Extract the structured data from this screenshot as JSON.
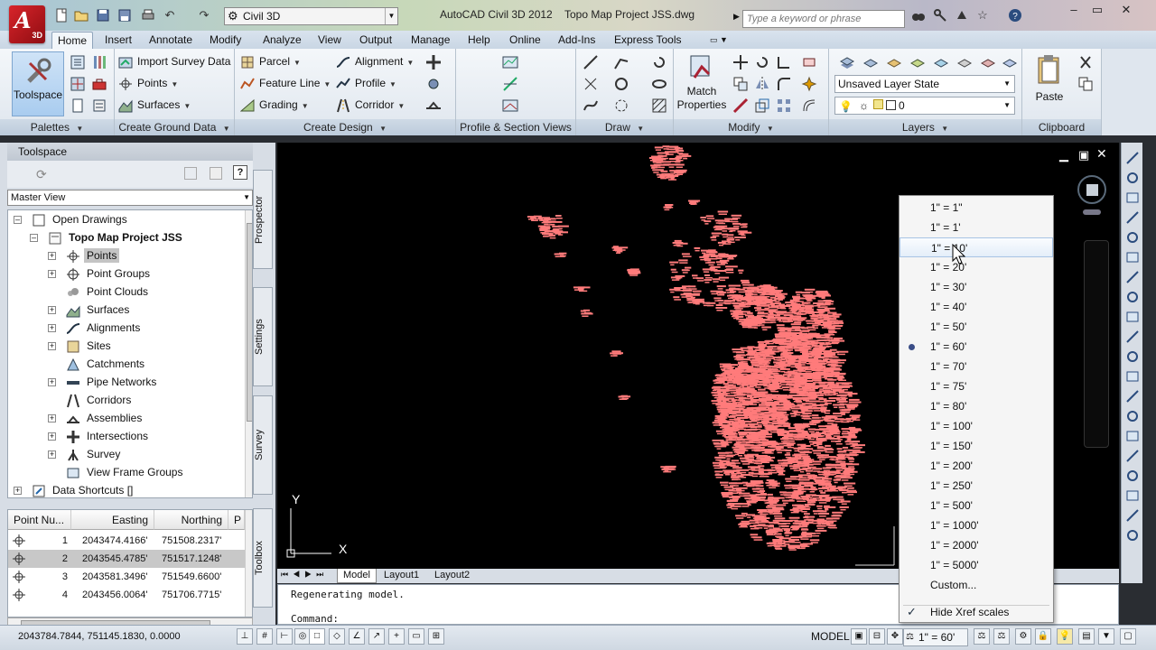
{
  "app": {
    "title": "AutoCAD Civil 3D 2012",
    "document": "Topo Map Project JSS.dwg",
    "logo_text": "3D",
    "logo_letter": "A",
    "workspace": "Civil 3D",
    "search_placeholder": "Type a keyword or phrase"
  },
  "ribbon_tabs": [
    "Home",
    "Insert",
    "Annotate",
    "Modify",
    "Analyze",
    "View",
    "Output",
    "Manage",
    "Help",
    "Online",
    "Add-Ins",
    "Express Tools"
  ],
  "ribbon": {
    "palettes": {
      "title": "Palettes",
      "toolspace": "Toolspace"
    },
    "ground": {
      "title": "Create Ground Data",
      "import": "Import Survey Data",
      "points": "Points",
      "surfaces": "Surfaces"
    },
    "design": {
      "title": "Create Design",
      "parcel": "Parcel",
      "feature_line": "Feature Line",
      "grading": "Grading",
      "alignment": "Alignment",
      "profile": "Profile",
      "corridor": "Corridor"
    },
    "profile_section": {
      "title": "Profile & Section Views"
    },
    "draw": {
      "title": "Draw"
    },
    "modify": {
      "title": "Modify",
      "match": "Match",
      "properties": "Properties"
    },
    "layers": {
      "title": "Layers",
      "layer_state": "Unsaved Layer State",
      "current_layer": "0"
    },
    "clipboard": {
      "title": "Clipboard",
      "paste": "Paste"
    }
  },
  "toolspace": {
    "header": "Toolspace",
    "view": "Master View",
    "tree": {
      "root": "Open Drawings",
      "drawing": "Topo Map Project JSS",
      "items": [
        "Points",
        "Point Groups",
        "Point Clouds",
        "Surfaces",
        "Alignments",
        "Sites",
        "Catchments",
        "Pipe Networks",
        "Corridors",
        "Assemblies",
        "Intersections",
        "Survey",
        "View Frame Groups"
      ],
      "shortcuts": "Data Shortcuts []"
    },
    "side_tabs": [
      "Prospector",
      "Settings",
      "Survey",
      "Toolbox"
    ],
    "table": {
      "columns": [
        "Point Nu...",
        "Easting",
        "Northing",
        "P"
      ],
      "rows": [
        {
          "num": "1",
          "easting": "2043474.4166'",
          "northing": "751508.2317'"
        },
        {
          "num": "2",
          "easting": "2043545.4785'",
          "northing": "751517.1248'"
        },
        {
          "num": "3",
          "easting": "2043581.3496'",
          "northing": "751549.6600'"
        },
        {
          "num": "4",
          "easting": "2043456.0064'",
          "northing": "751706.7715'"
        }
      ]
    }
  },
  "drawing": {
    "ucs_x": "X",
    "ucs_y": "Y",
    "point_color": "#ff7b7b",
    "layout_tabs": [
      "Model",
      "Layout1",
      "Layout2"
    ]
  },
  "command": {
    "history": "Regenerating model.",
    "prompt": "Command:"
  },
  "status": {
    "coords": "2043784.7844, 751145.1830, 0.0000",
    "space": "MODEL",
    "scale": "1\" = 60'"
  },
  "scale_menu": {
    "items": [
      "1\" = 1\"",
      "1\" = 1'",
      "1\" = 10'",
      "1\" = 20'",
      "1\" = 30'",
      "1\" = 40'",
      "1\" = 50'",
      "1\" = 60'",
      "1\" = 70'",
      "1\" = 75'",
      "1\" = 80'",
      "1\" = 100'",
      "1\" = 150'",
      "1\" = 200'",
      "1\" = 250'",
      "1\" = 500'",
      "1\" = 1000'",
      "1\" = 2000'",
      "1\" = 5000'",
      "Custom..."
    ],
    "selected_index": 7,
    "hover_index": 2,
    "hide_xref": "Hide Xref scales"
  }
}
